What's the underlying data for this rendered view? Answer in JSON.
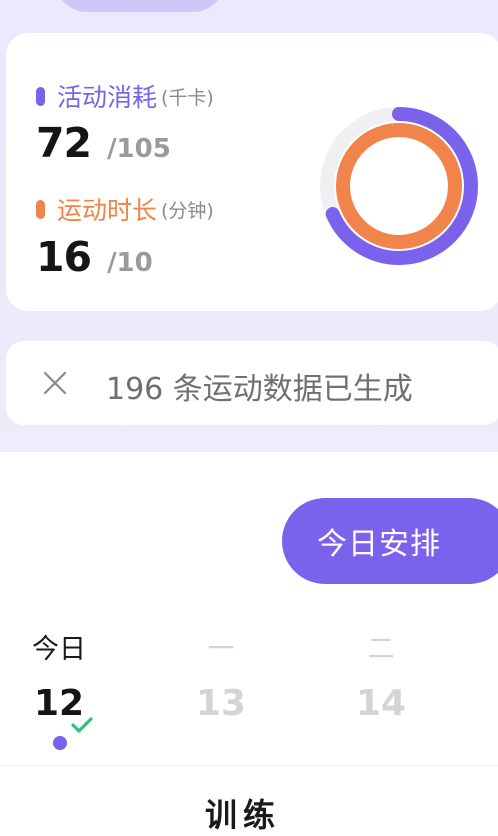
{
  "colors": {
    "accent_purple": "#7a62ec",
    "accent_orange": "#f0844a",
    "ring_track": "#f0eff2"
  },
  "summary": {
    "calories": {
      "label": "活动消耗",
      "unit": "(千卡)",
      "value": "72",
      "goal": "/105",
      "progress": 0.686
    },
    "duration": {
      "label": "运动时长",
      "unit": "(分钟)",
      "value": "16",
      "goal": "/10",
      "progress": 1.0
    }
  },
  "notice": {
    "icon": "close-icon",
    "text": "196 条运动数据已生成"
  },
  "schedule": {
    "button_label": "今日安排",
    "days": [
      {
        "weekday": "今日",
        "day": "12",
        "completed": true,
        "selected": true
      },
      {
        "weekday": "一",
        "day": "13"
      },
      {
        "weekday": "二",
        "day": "14"
      }
    ]
  },
  "section": {
    "title": "训练"
  }
}
